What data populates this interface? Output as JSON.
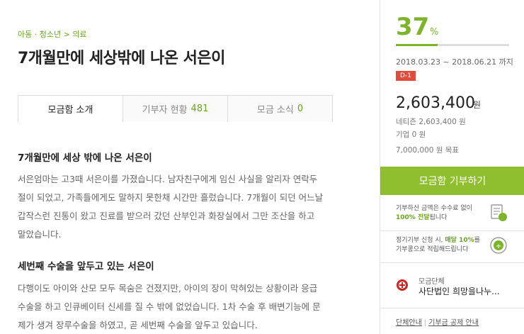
{
  "main": {
    "breadcrumb": "아동 · 청소년 > 의료",
    "title": "7개월만에 세상밖에 나온 서은이",
    "tabs": [
      {
        "label": "모금함 소개",
        "count": ""
      },
      {
        "label": "기부자 현황",
        "count": "481"
      },
      {
        "label": "모금 소식",
        "count": "0"
      }
    ],
    "section1": {
      "title": "7개월만에 세상 밖에 나온 서은이",
      "lines": [
        "서은엄마는 고3때 서은이를 가졌습니다. 남자친구에게 임신 사실을 알리자 연락두",
        "절이 되었고, 가족들에게도 말하지 못한채 시간만 흘렀습니다. 7개월이 되던 어느날",
        "갑작스런 진통이 왔고 진료를 받으러 갔던 산부인과 화장실에서 그만 조산을 하고",
        "말았습니다."
      ]
    },
    "section2": {
      "title": "세번째 수술을 앞두고 있는 서은이",
      "lines": [
        "다행이도 아이와 산모 모두 목숨은 건졌지만, 아이의 장이 막혀있는 상황이라 응급",
        "수술을 하고 인큐베이터 신세를 질 수 밖에 없었습니다. 1차 수술 후 배변기능에 문",
        "제가 생겨 장루수술을 하였고, 곧 세번째 수술을 앞두고 있습니다."
      ]
    }
  },
  "side": {
    "percent": "37",
    "percent_sign": "%",
    "progress_value": 0.37,
    "period": "2018.03.23 ~ 2018.06.21 까지",
    "dday": "D-1",
    "amount": "2,603,400",
    "amount_unit": "원",
    "netizen": "네티즌 2,603,400 원",
    "company": "기업 0 원",
    "goal": "7,000,000 원 목표",
    "donate_button": "모금함 기부하기",
    "info1": {
      "line1": "기부하신 금액은 수수료 없이",
      "hl": "100% 전달",
      "rest": "됩니다"
    },
    "info2": {
      "pre": "정기기부 신청 시, ",
      "hl": "매달 10%",
      "post": "를",
      "line2": "기부콩으로 적립해드립니다"
    },
    "org_label": "모금단체",
    "org_name": "사단법인 희망을나누...",
    "org_link1": "단체안내",
    "org_link2": "기부금 공제 안내"
  },
  "colors": {
    "accent": "#7cb529",
    "button": "#8fbf2f",
    "badge": "#e24a3a"
  }
}
